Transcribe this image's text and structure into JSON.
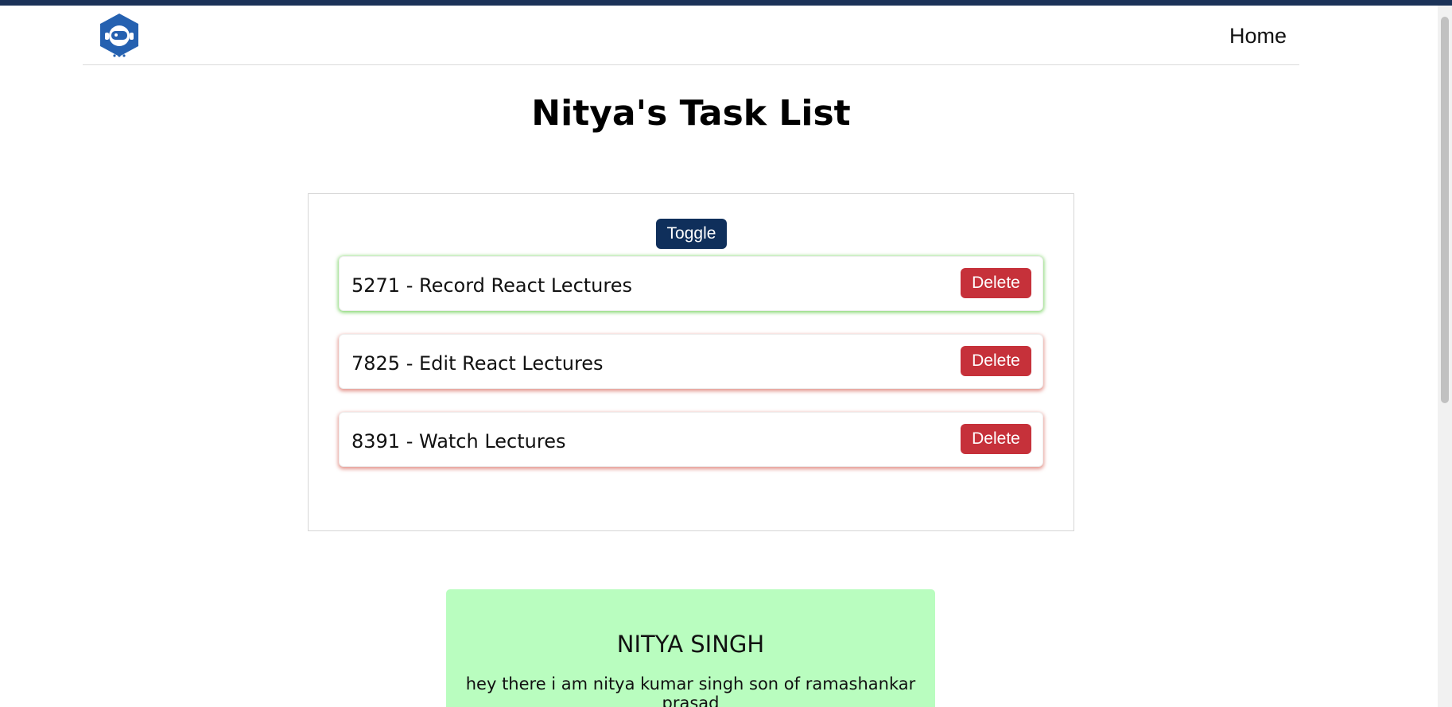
{
  "header": {
    "logo_icon": "robot-astronaut-icon",
    "nav_home": "Home"
  },
  "page_title": "Nitya's Task List",
  "task_panel": {
    "toggle_label": "Toggle",
    "tasks": [
      {
        "text": "5271 - Record React Lectures",
        "delete_label": "Delete",
        "status_color": "#5ac83c"
      },
      {
        "text": "7825 - Edit React Lectures",
        "delete_label": "Delete",
        "status_color": "#dc786e"
      },
      {
        "text": "8391 - Watch Lectures",
        "delete_label": "Delete",
        "status_color": "#dc786e"
      }
    ]
  },
  "profile_card": {
    "name": "NITYA SINGH",
    "bio": "hey there i am nitya kumar singh son of ramashankar prasad",
    "background_color": "#b9fdbf"
  },
  "colors": {
    "top_strip": "#1b3258",
    "primary_button": "#0f2f5b",
    "danger_button": "#c6313a"
  }
}
